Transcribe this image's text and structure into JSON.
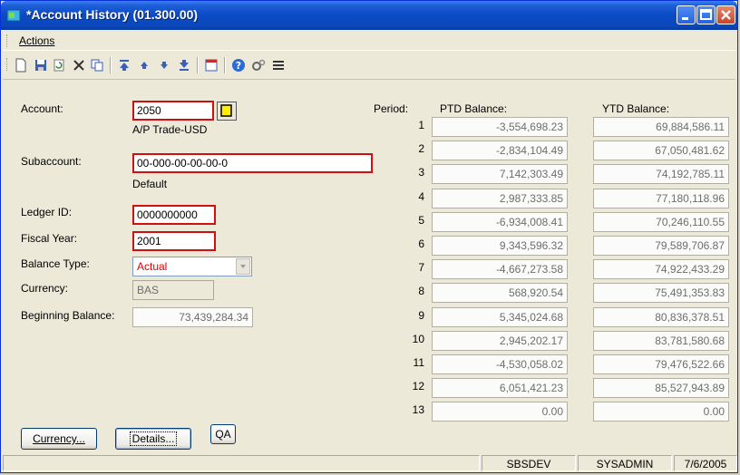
{
  "window": {
    "title": "*Account History (01.300.00)"
  },
  "menu": {
    "actions": "Actions"
  },
  "toolbar": {
    "icons": [
      "new-icon",
      "save-icon",
      "refresh-icon",
      "delete-icon",
      "copy-icon",
      "first-icon",
      "previous-icon",
      "next-icon",
      "last-icon",
      "form-icon",
      "help-icon",
      "tools-icon",
      "list-icon"
    ]
  },
  "form": {
    "account_label": "Account:",
    "account_value": "2050",
    "account_desc": "A/P Trade-USD",
    "subaccount_label": "Subaccount:",
    "subaccount_value": "00-000-00-00-00-0",
    "subaccount_desc": "Default",
    "ledger_label": "Ledger ID:",
    "ledger_value": "0000000000",
    "fiscal_label": "Fiscal Year:",
    "fiscal_value": "2001",
    "balance_type_label": "Balance Type:",
    "balance_type_value": "Actual",
    "currency_label": "Currency:",
    "currency_value": "BAS",
    "beginning_label": "Beginning Balance:",
    "beginning_value": "73,439,284.34"
  },
  "buttons": {
    "currency": "Currency...",
    "details": "Details...",
    "qa": "QA"
  },
  "grid": {
    "period_header": "Period:",
    "ptd_header": "PTD Balance:",
    "ytd_header": "YTD Balance:",
    "rows": [
      {
        "period": "1",
        "ptd": "-3,554,698.23",
        "ytd": "69,884,586.11"
      },
      {
        "period": "2",
        "ptd": "-2,834,104.49",
        "ytd": "67,050,481.62"
      },
      {
        "period": "3",
        "ptd": "7,142,303.49",
        "ytd": "74,192,785.11"
      },
      {
        "period": "4",
        "ptd": "2,987,333.85",
        "ytd": "77,180,118.96"
      },
      {
        "period": "5",
        "ptd": "-6,934,008.41",
        "ytd": "70,246,110.55"
      },
      {
        "period": "6",
        "ptd": "9,343,596.32",
        "ytd": "79,589,706.87"
      },
      {
        "period": "7",
        "ptd": "-4,667,273.58",
        "ytd": "74,922,433.29"
      },
      {
        "period": "8",
        "ptd": "568,920.54",
        "ytd": "75,491,353.83"
      },
      {
        "period": "9",
        "ptd": "5,345,024.68",
        "ytd": "80,836,378.51"
      },
      {
        "period": "10",
        "ptd": "2,945,202.17",
        "ytd": "83,781,580.68"
      },
      {
        "period": "11",
        "ptd": "-4,530,058.02",
        "ytd": "79,476,522.66"
      },
      {
        "period": "12",
        "ptd": "6,051,421.23",
        "ytd": "85,527,943.89"
      },
      {
        "period": "13",
        "ptd": "0.00",
        "ytd": "0.00"
      }
    ]
  },
  "status": {
    "server": "SBSDEV",
    "user": "SYSADMIN",
    "date": "7/6/2005"
  },
  "colors": {
    "required_border": "#d01010",
    "title_bar": "#0a4ac4",
    "actual_text": "#e00000"
  }
}
